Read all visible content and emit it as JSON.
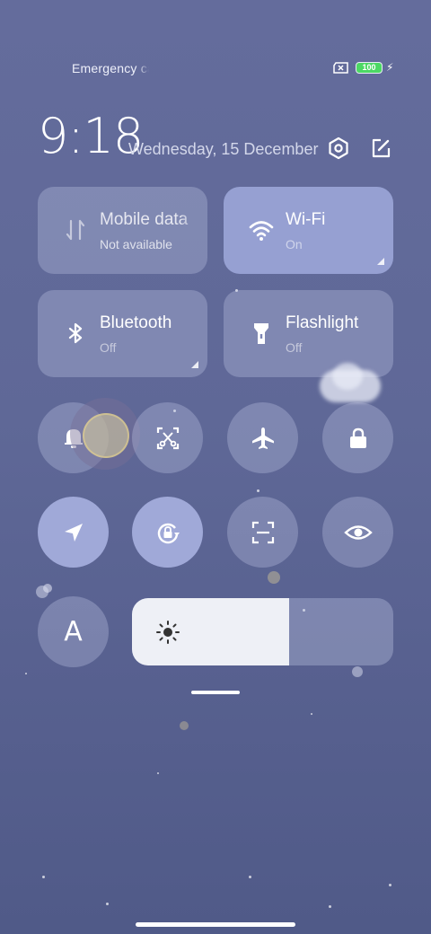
{
  "status_bar": {
    "carrier_text": "Emergency calls only",
    "battery_level": "100",
    "charging": true
  },
  "header": {
    "time": "9:18",
    "date": "Wednesday, 15 December"
  },
  "tiles": [
    {
      "title": "Mobile data",
      "subtitle": "Not available",
      "icon": "mobile-data-icon",
      "active": false
    },
    {
      "title": "Wi-Fi",
      "subtitle": "On",
      "icon": "wifi-icon",
      "active": true
    },
    {
      "title": "Bluetooth",
      "subtitle": "Off",
      "icon": "bluetooth-icon",
      "active": false
    },
    {
      "title": "Flashlight",
      "subtitle": "Off",
      "icon": "flashlight-icon",
      "active": false
    }
  ],
  "toggles_row1": [
    "bell-icon",
    "screenshot-icon",
    "airplane-icon",
    "lock-icon"
  ],
  "toggles_row2": [
    "location-icon",
    "rotation-lock-icon",
    "scanner-icon",
    "eye-icon"
  ],
  "reading_mode": {
    "label": "A"
  },
  "brightness": {
    "level": 0.6
  },
  "colors": {
    "accent_tile": "#96a0d2",
    "accent_round": "#a0a9d8",
    "battery": "#4cd964"
  }
}
